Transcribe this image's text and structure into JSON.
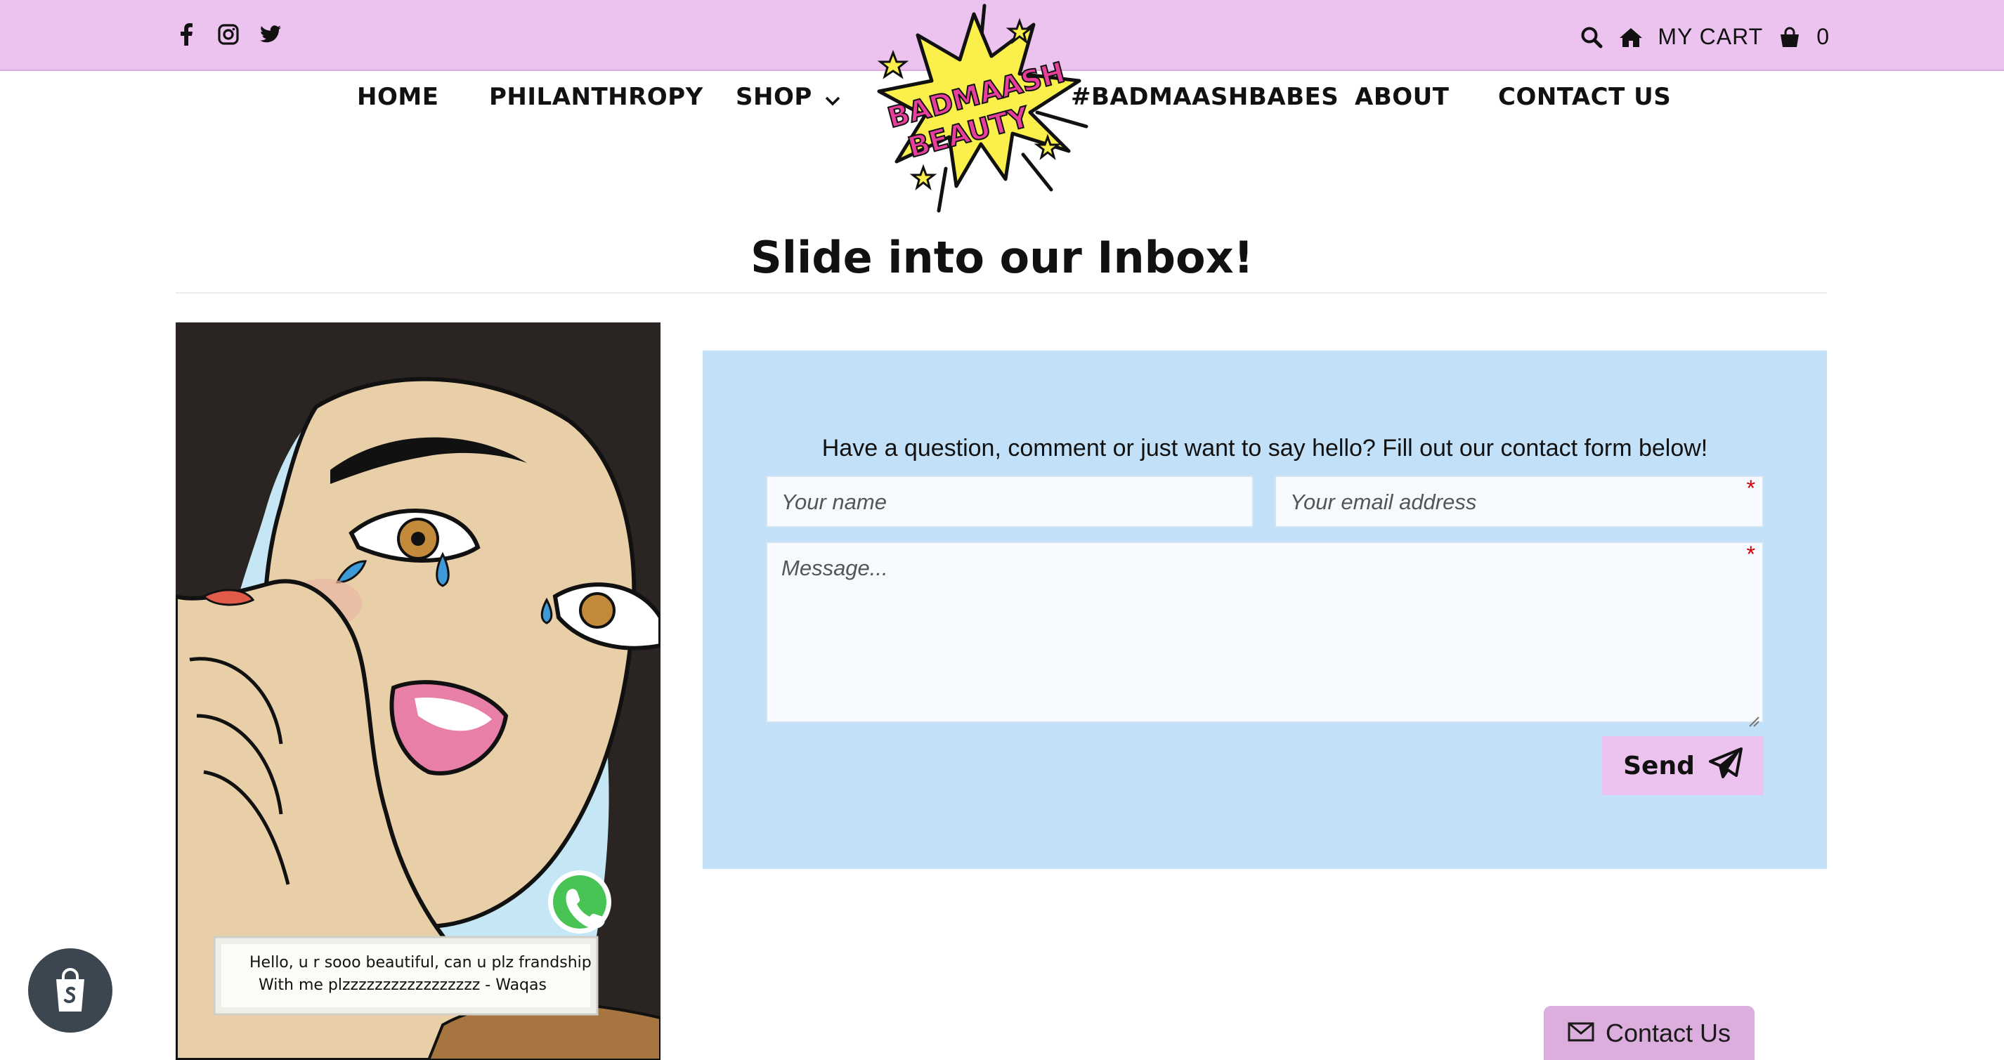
{
  "topbar": {
    "social_icons": [
      "facebook-icon",
      "instagram-icon",
      "twitter-icon"
    ],
    "cart_label": "MY CART",
    "cart_count": "0"
  },
  "nav": {
    "items": [
      "HOME",
      "PHILANTHROPY",
      "SHOP",
      "#BADMAASHBABES",
      "ABOUT",
      "CONTACT US"
    ]
  },
  "logo": {
    "line1": "BADMAASH",
    "line2": "BEAUTY"
  },
  "page": {
    "title": "Slide into our Inbox!"
  },
  "artwork": {
    "caption_line1": "Hello, u r sooo beautiful, can u plz frandship",
    "caption_line2": "With me plzzzzzzzzzzzzzzzzz - Waqas"
  },
  "form": {
    "intro": "Have a question, comment or just want to say hello? Fill out our contact form below!",
    "name_placeholder": "Your name",
    "email_placeholder": "Your email address",
    "message_placeholder": "Message...",
    "required_mark": "*",
    "send_label": "Send"
  },
  "widgets": {
    "contact_tab_label": "Contact Us"
  },
  "colors": {
    "pink": "#ecc2ee",
    "form_blue": "#c2e0f7",
    "shopify_dark": "#3c4650"
  }
}
